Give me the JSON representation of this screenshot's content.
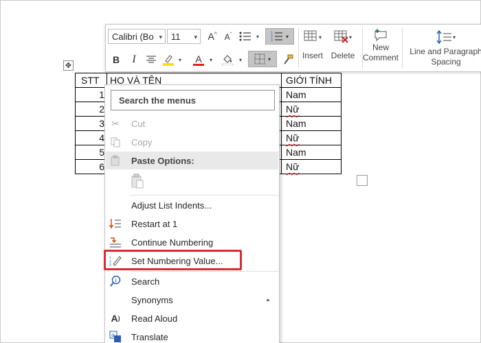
{
  "toolbar": {
    "font_name": "Calibri (Bo",
    "font_size": "11",
    "insert_label": "Insert",
    "delete_label": "Delete",
    "new_comment_line1": "New",
    "new_comment_line2": "Comment",
    "spacing_line1": "Line and Paragraph",
    "spacing_line2": "Spacing",
    "bold": "B",
    "italic": "I",
    "font_color_letter": "A",
    "grow_font": "A",
    "shrink_font": "A",
    "colors": {
      "font_color": "#e02020",
      "highlight": "#f5e400",
      "accent": "#217346"
    }
  },
  "table": {
    "headers": [
      "STT",
      "HỌ VÀ TÊN",
      "GIỚI TÍNH"
    ],
    "rows": [
      {
        "stt": "1",
        "name": "",
        "gender": "Nam"
      },
      {
        "stt": "2",
        "name": "",
        "gender": "Nữ"
      },
      {
        "stt": "3",
        "name": "",
        "gender": "Nam"
      },
      {
        "stt": "4",
        "name": "",
        "gender": "Nữ"
      },
      {
        "stt": "5",
        "name": "",
        "gender": "Nam"
      },
      {
        "stt": "6",
        "name": "",
        "gender": "Nữ"
      }
    ]
  },
  "context_menu": {
    "search": "Search the menus",
    "cut": "Cut",
    "copy": "Copy",
    "paste_options": "Paste Options:",
    "adjust_list_indents": "Adjust List Indents...",
    "restart_at_1": "Restart at 1",
    "continue_numbering": "Continue Numbering",
    "set_numbering_value": "Set Numbering Value...",
    "search_item": "Search",
    "synonyms": "Synonyms",
    "read_aloud": "Read Aloud",
    "translate": "Translate"
  },
  "icons": {
    "cut": "scissors-icon",
    "copy": "copy-icon",
    "paste": "clipboard-icon",
    "restart": "restart-numbering-icon",
    "continue": "continue-numbering-icon",
    "set_value": "set-numbering-value-icon",
    "search": "search-info-icon",
    "read_aloud": "read-aloud-icon",
    "translate": "translate-icon"
  },
  "highlight_color": "#e0282e"
}
